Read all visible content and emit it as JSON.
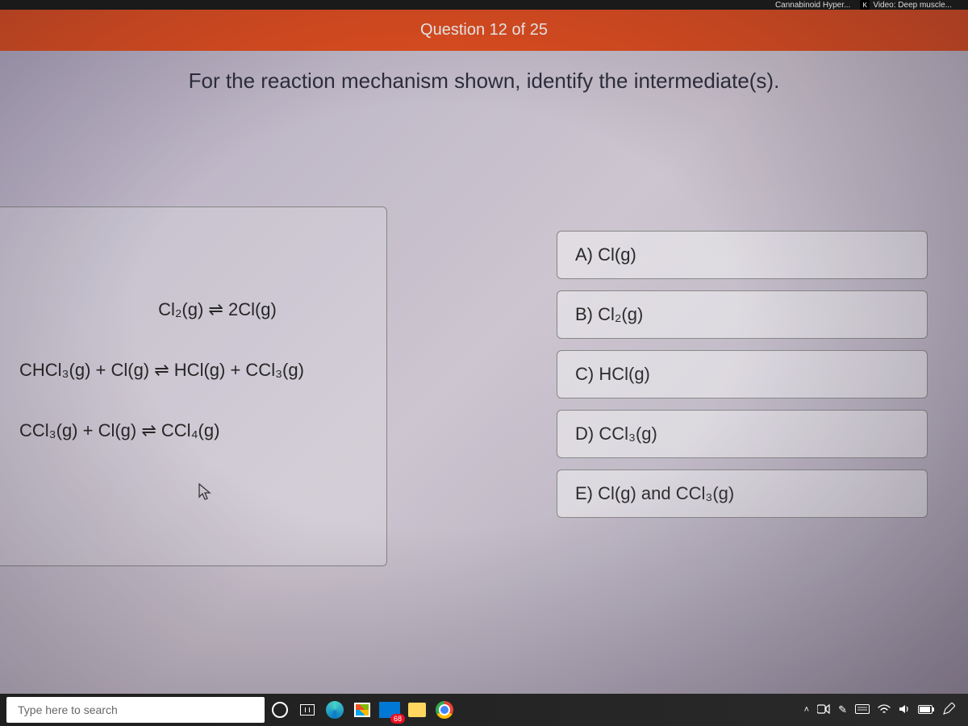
{
  "browser": {
    "tabs": [
      {
        "label": "Cannabinoid Hyper..."
      },
      {
        "label": "Video: Deep muscle..."
      }
    ]
  },
  "quiz": {
    "header": "Question 12 of 25",
    "prompt": "For the reaction mechanism shown, identify the intermediate(s).",
    "mechanism": {
      "step1": "Cl₂(g)  ⇌  2Cl(g)",
      "step2": "CHCl₃(g) +   Cl(g)   ⇌  HCl(g)  +  CCl₃(g)",
      "step3": "CCl₃(g)  +   Cl(g)   ⇌ CCl₄(g)"
    },
    "answers": {
      "a": "A) Cl(g)",
      "b": "B) Cl₂(g)",
      "c": "C) HCl(g)",
      "d": "D) CCl₃(g)",
      "e": "E) Cl(g) and CCl₃(g)"
    }
  },
  "taskbar": {
    "search_placeholder": "Type here to search",
    "mail_badge": "68"
  }
}
